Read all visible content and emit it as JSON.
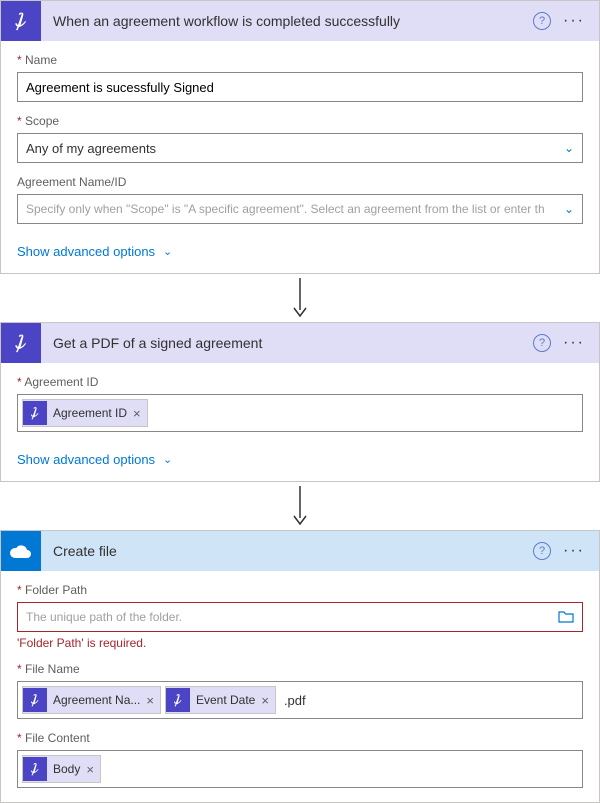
{
  "card1": {
    "title": "When an agreement workflow is completed successfully",
    "nameLabel": "Name",
    "nameValue": "Agreement is sucessfully Signed",
    "scopeLabel": "Scope",
    "scopeValue": "Any of my agreements",
    "agreementLabel": "Agreement Name/ID",
    "agreementPlaceholder": "Specify only when \"Scope\" is \"A specific agreement\". Select an agreement from the list or enter th",
    "showAdvanced": "Show advanced options"
  },
  "card2": {
    "title": "Get a PDF of a signed agreement",
    "agreementIdLabel": "Agreement ID",
    "tokenAgreementId": "Agreement ID",
    "showAdvanced": "Show advanced options"
  },
  "card3": {
    "title": "Create file",
    "folderPathLabel": "Folder Path",
    "folderPathPlaceholder": "The unique path of the folder.",
    "folderPathError": "'Folder Path' is required.",
    "fileNameLabel": "File Name",
    "tokenAgreementName": "Agreement Na...",
    "tokenEventDate": "Event Date",
    "fileNameSuffix": ".pdf",
    "fileContentLabel": "File Content",
    "tokenBody": "Body"
  }
}
